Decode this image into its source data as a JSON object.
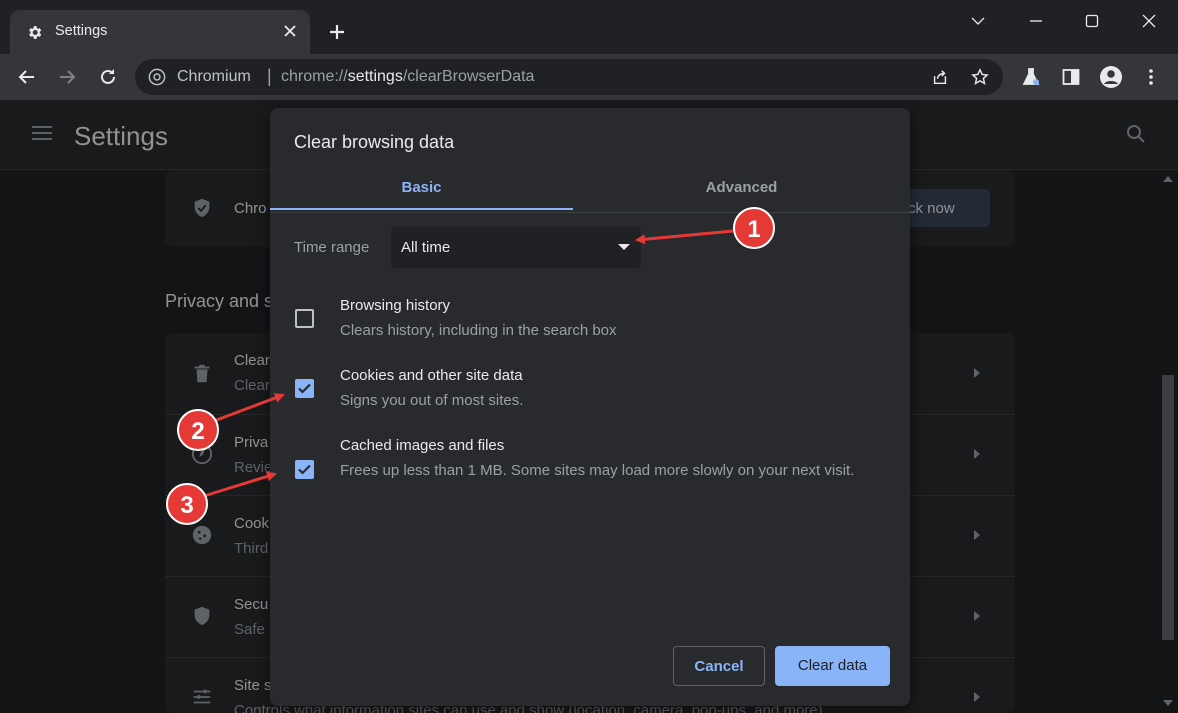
{
  "browser": {
    "tab_title": "Settings",
    "omnibox_site": "Chromium",
    "omnibox_url_scheme": "chrome://",
    "omnibox_url_host": "settings",
    "omnibox_url_path": "/clearBrowserData"
  },
  "settings_page": {
    "title": "Settings",
    "safety_row_text": "Chro",
    "check_now_label": "ck now",
    "section_title": "Privacy and s",
    "rows": [
      {
        "title": "Clear",
        "subtitle": "Clear"
      },
      {
        "title": "Priva",
        "subtitle": "Revie"
      },
      {
        "title": "Cook",
        "subtitle": "Third"
      },
      {
        "title": "Secu",
        "subtitle": "Safe"
      },
      {
        "title": "Site s",
        "subtitle": "Controls what information sites can use and show (location, camera, pop-ups, and more)"
      }
    ]
  },
  "dialog": {
    "title": "Clear browsing data",
    "tabs": [
      {
        "label": "Basic",
        "selected": true
      },
      {
        "label": "Advanced",
        "selected": false
      }
    ],
    "time_range": {
      "label": "Time range",
      "selected_value": "All time"
    },
    "options": [
      {
        "title": "Browsing history",
        "description": "Clears history, including in the search box",
        "checked": false
      },
      {
        "title": "Cookies and other site data",
        "description": "Signs you out of most sites.",
        "checked": true
      },
      {
        "title": "Cached images and files",
        "description": "Frees up less than 1 MB. Some sites may load more slowly on your next visit.",
        "checked": true
      }
    ],
    "cancel_label": "Cancel",
    "confirm_label": "Clear data"
  },
  "annotations": {
    "badges": [
      "1",
      "2",
      "3"
    ],
    "badge_color": "#e53935",
    "arrow_color": "#e53935"
  },
  "colors": {
    "accent": "#8ab4f8",
    "dialog_bg": "#292a2d",
    "window_bg": "#202124"
  }
}
